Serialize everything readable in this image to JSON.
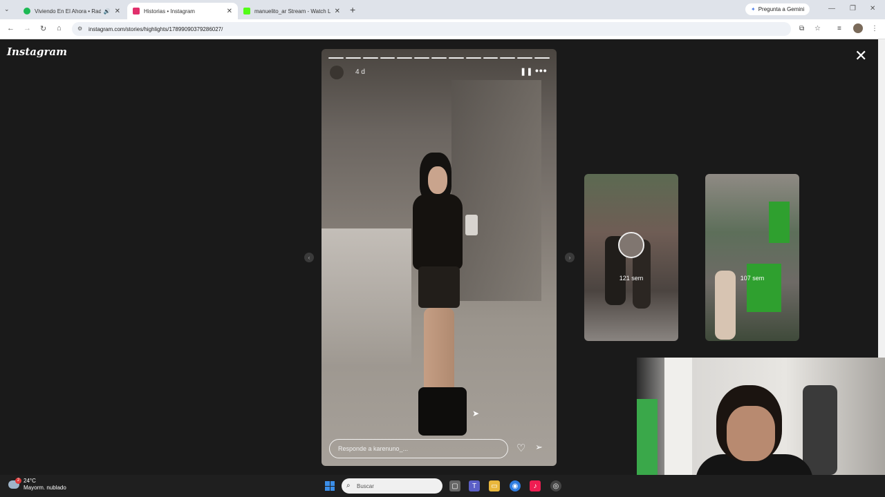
{
  "browser": {
    "tabs": [
      {
        "title": "Viviendo En El Ahora • Radi",
        "favicon_color": "#1db954",
        "active": false,
        "audio": true
      },
      {
        "title": "Historias • Instagram",
        "favicon_color": "#e1306c",
        "active": true,
        "audio": false
      },
      {
        "title": "manuelito_ar Stream - Watch Li",
        "favicon_color": "#53fc18",
        "active": false,
        "audio": false
      }
    ],
    "gemini_label": "Pregunta a Gemini",
    "url": "instagram.com/stories/highlights/17899090379286027/"
  },
  "instagram": {
    "logo": "Instagram",
    "story": {
      "time_ago": "4 d",
      "segments": 13,
      "reply_placeholder": "Responde a karenuno_..."
    },
    "previews": [
      {
        "label": "121 sem"
      },
      {
        "label": "107 sem"
      }
    ]
  },
  "taskbar": {
    "weather_temp": "24°C",
    "weather_desc": "Mayorm. nublado",
    "weather_badge": "2",
    "search_placeholder": "Buscar"
  },
  "colors": {
    "page_bg": "#1a1a1a",
    "accent_blue": "#3b8ee8"
  }
}
